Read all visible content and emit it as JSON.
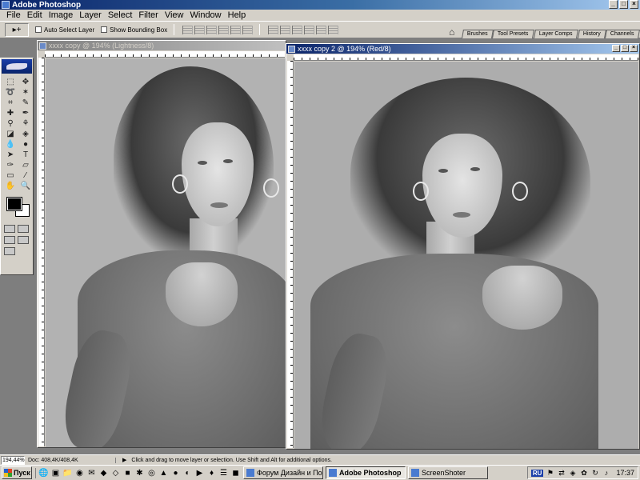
{
  "app": {
    "title": "Adobe Photoshop"
  },
  "menu": [
    "File",
    "Edit",
    "Image",
    "Layer",
    "Select",
    "Filter",
    "View",
    "Window",
    "Help"
  ],
  "options": {
    "tool_preset_icon": "▸+",
    "auto_select_layer": "Auto Select Layer",
    "show_bounding_box": "Show Bounding Box"
  },
  "palette_tabs": [
    "Brushes",
    "Tool Presets",
    "Layer Comps",
    "History",
    "Channels"
  ],
  "doc1": {
    "title": "xxxx copy @ 194% (Lightness/8)"
  },
  "doc2": {
    "title": "xxxx copy 2 @ 194% (Red/8)"
  },
  "window_controls": {
    "min": "_",
    "max": "□",
    "close": "×"
  },
  "status": {
    "zoom": "194,44%",
    "doc_info": "Doc: 408,4K/408,4K",
    "arrow": "▶",
    "message": "Click and drag to move layer or selection.  Use Shift and Alt for additional options."
  },
  "taskbar": {
    "start": "Пуск",
    "tasks": [
      "Форум Дизайн и По...",
      "Adobe Photoshop",
      "ScreenShoter"
    ],
    "lang": "RU",
    "clock": "17:37"
  }
}
